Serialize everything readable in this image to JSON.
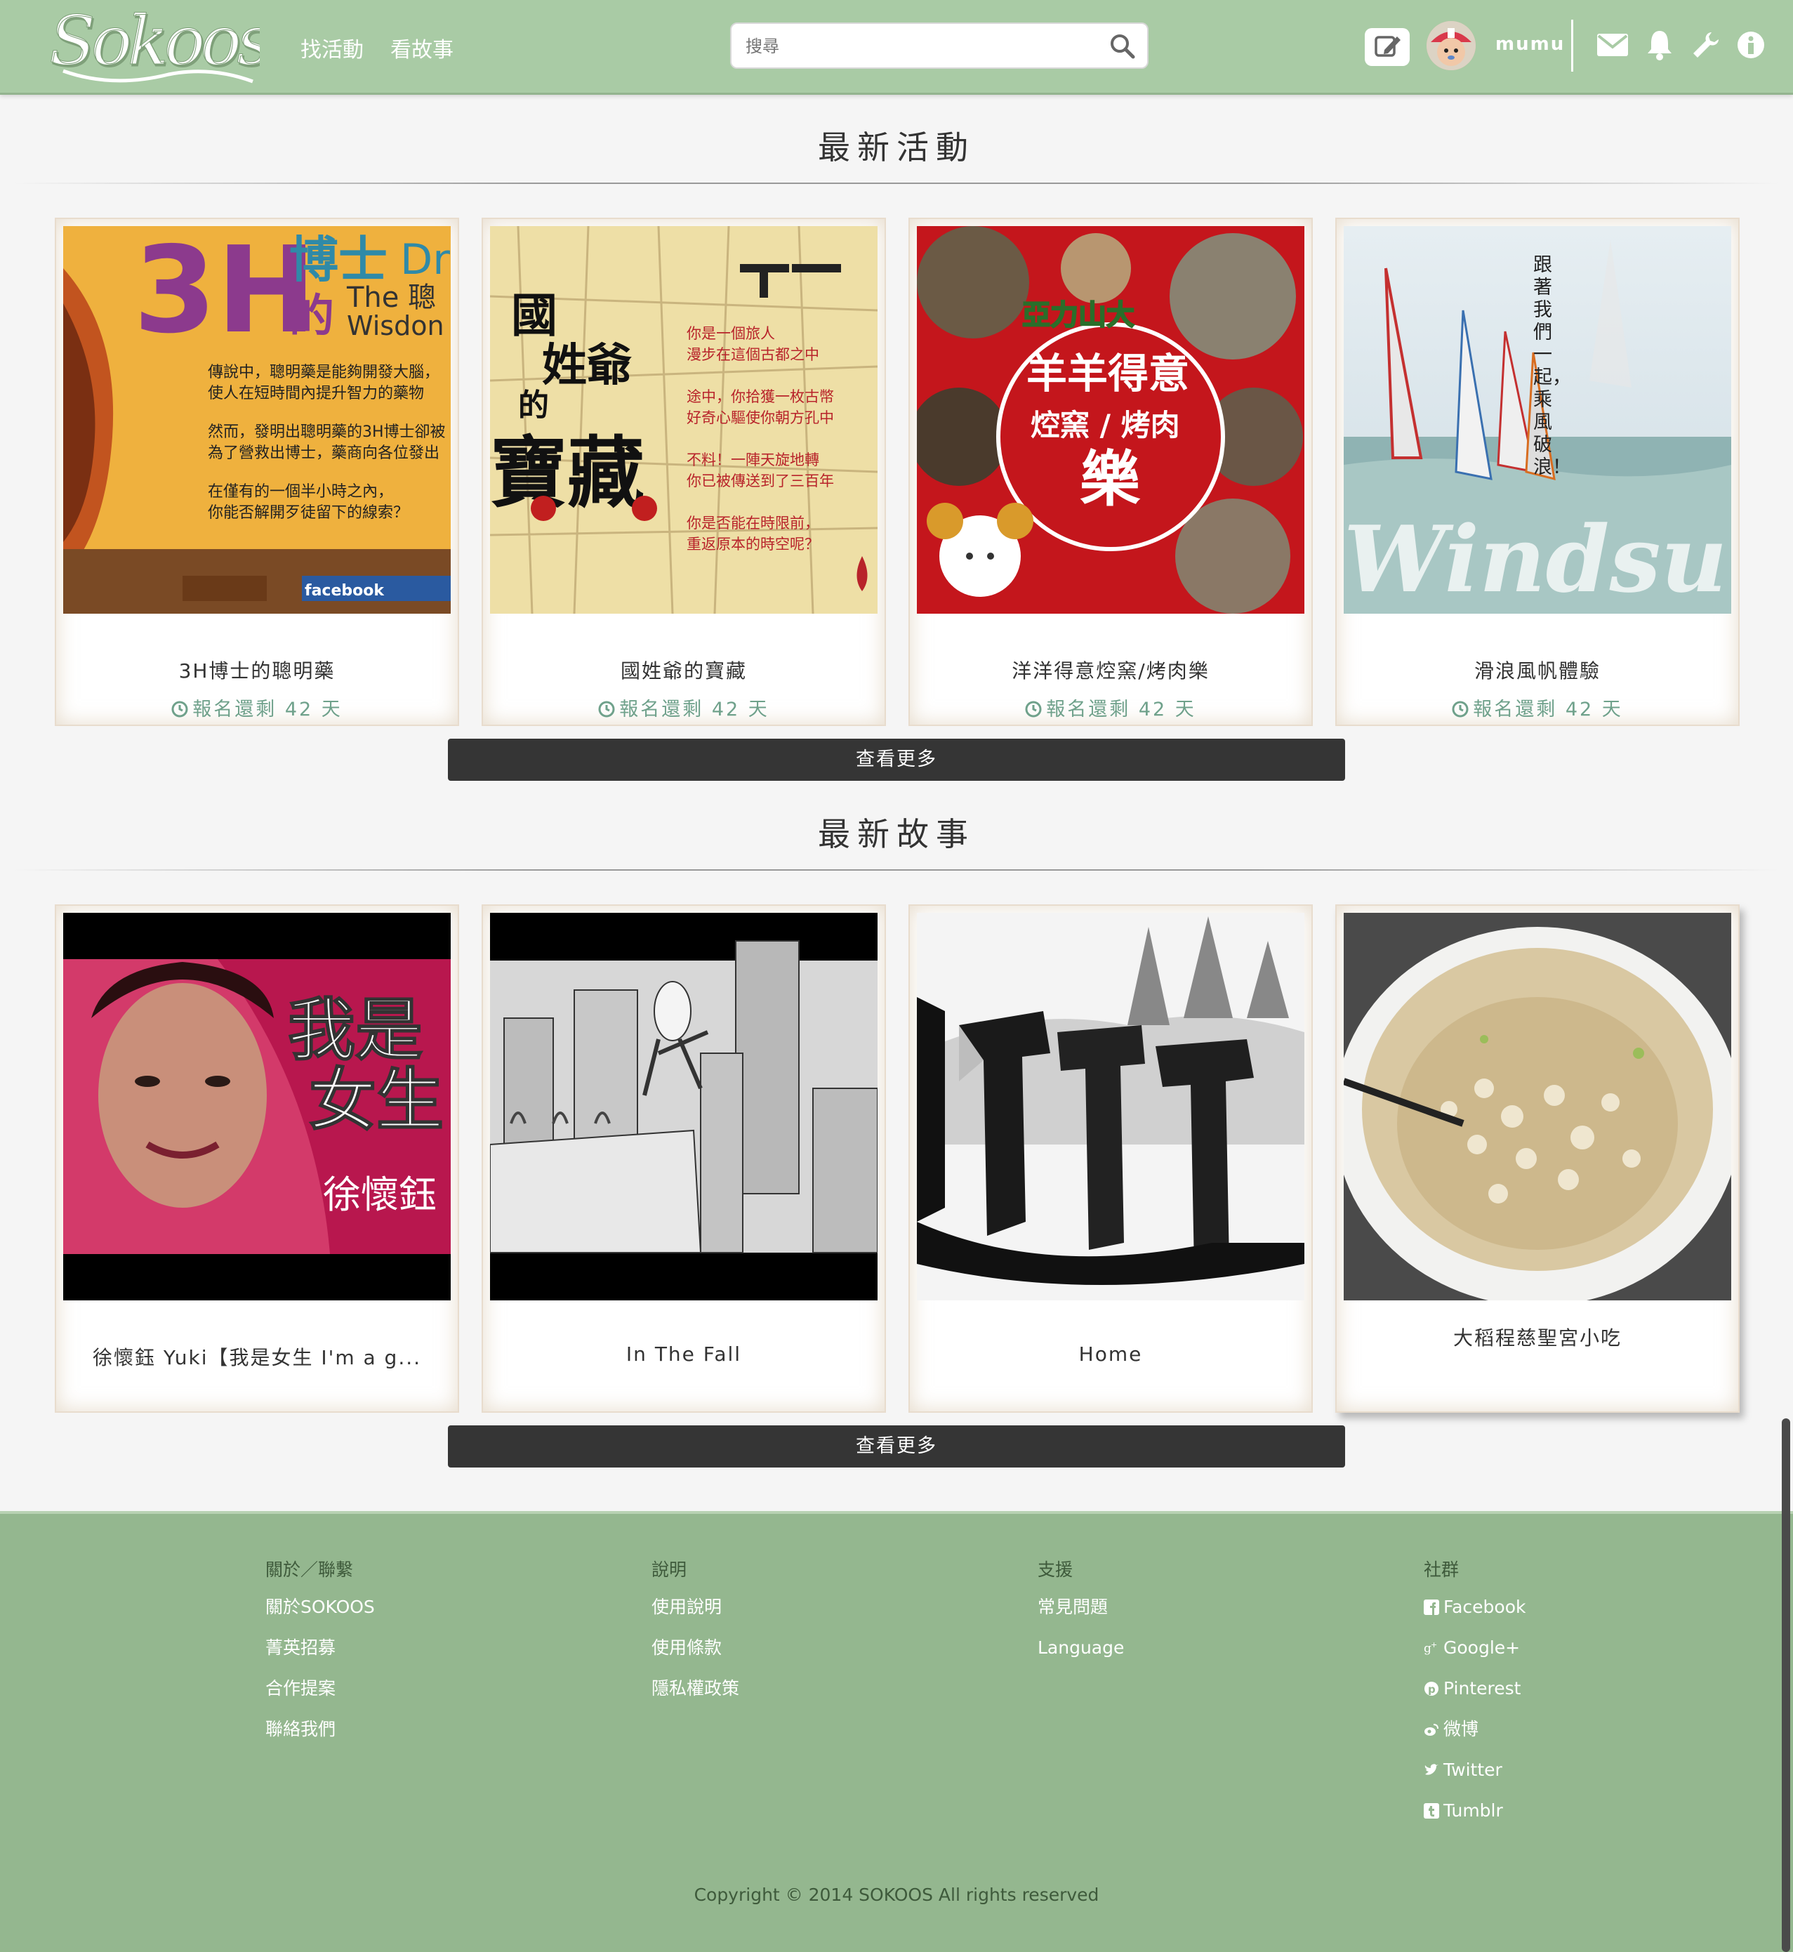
{
  "header": {
    "logo_text": "Sokoos",
    "nav": [
      "找活動",
      "看故事"
    ],
    "search_placeholder": "搜尋",
    "username": "mumu",
    "icons": [
      "compose-icon",
      "envelope-icon",
      "bell-icon",
      "wrench-icon",
      "info-icon"
    ]
  },
  "events": {
    "title": "最新活動",
    "more_label": "查看更多",
    "items": [
      {
        "title": "3H博士的聰明藥",
        "deadline": "報名還剩 42 天"
      },
      {
        "title": "國姓爺的寶藏",
        "deadline": "報名還剩 42 天"
      },
      {
        "title": "洋洋得意焢窯/烤肉樂",
        "deadline": "報名還剩 42 天"
      },
      {
        "title": "滑浪風帆體驗",
        "deadline": "報名還剩 42 天"
      }
    ],
    "thumb_text": {
      "card1_big": "3H",
      "card1_title": "博士",
      "card1_title2": "的",
      "card1_sub": "The 聰",
      "card1_dr": "Dr",
      "card1_wisdom": "Wisdon",
      "card1_p1": "傳說中，聰明藥是能夠開發大腦，",
      "card1_p1b": "使人在短時間內提升智力的藥物",
      "card1_p2": "然而，發明出聰明藥的3H博士卻被",
      "card1_p2b": "為了營救出博士，藥商向各位發出",
      "card1_p3": "在僅有的一個半小時之內，",
      "card1_p3b": "你能否解開歹徒留下的線索？",
      "card1_fb": "facebook",
      "card2_big1": "國",
      "card2_big2": "姓爺",
      "card2_big3": "的",
      "card2_big4": "寶藏",
      "card2_lines": [
        "你是一個旅人",
        "漫步在這個古都之中",
        "途中，你拾獲一枚古幣",
        "好奇心驅使你朝方孔中",
        "不料！一陣天旋地轉",
        "你已被傳送到了三百年",
        "你是否能在時限前，",
        "重返原本的時空呢？"
      ],
      "card3_top": "亞力山大",
      "card3_l1": "羊羊得意",
      "card3_l2": "焢窯 / 烤肉",
      "card3_l3": "樂",
      "card4_vertical": "跟著我們一起，乘風破浪！",
      "card4_word": "Windsurfi"
    }
  },
  "stories": {
    "title": "最新故事",
    "more_label": "查看更多",
    "items": [
      {
        "title": "徐懷鈺 Yuki【我是女生 I'm a g..."
      },
      {
        "title": "In The Fall"
      },
      {
        "title": "Home"
      },
      {
        "title": "大稻程慈聖宮小吃"
      }
    ],
    "thumb_text": {
      "card1_l1": "我是",
      "card1_l2": "女生",
      "card1_l3": "徐懷鈺"
    }
  },
  "footer": {
    "columns": [
      {
        "heading": "關於／聯繫",
        "links": [
          "關於SOKOOS",
          "菁英招募",
          "合作提案",
          "聯絡我們"
        ]
      },
      {
        "heading": "說明",
        "links": [
          "使用說明",
          "使用條款",
          "隱私權政策"
        ]
      },
      {
        "heading": "支援",
        "links": [
          "常見問題",
          "Language"
        ]
      },
      {
        "heading": "社群",
        "links": [
          "Facebook",
          "Google+",
          "Pinterest",
          "微博",
          "Twitter",
          "Tumblr"
        ]
      }
    ],
    "copyright": "Copyright © 2014 SOKOOS All rights reserved"
  },
  "colors": {
    "header_bg": "#a9cba5",
    "footer_bg": "#94b78f",
    "accent_green": "#6fa18b",
    "button_dark": "#353535"
  }
}
